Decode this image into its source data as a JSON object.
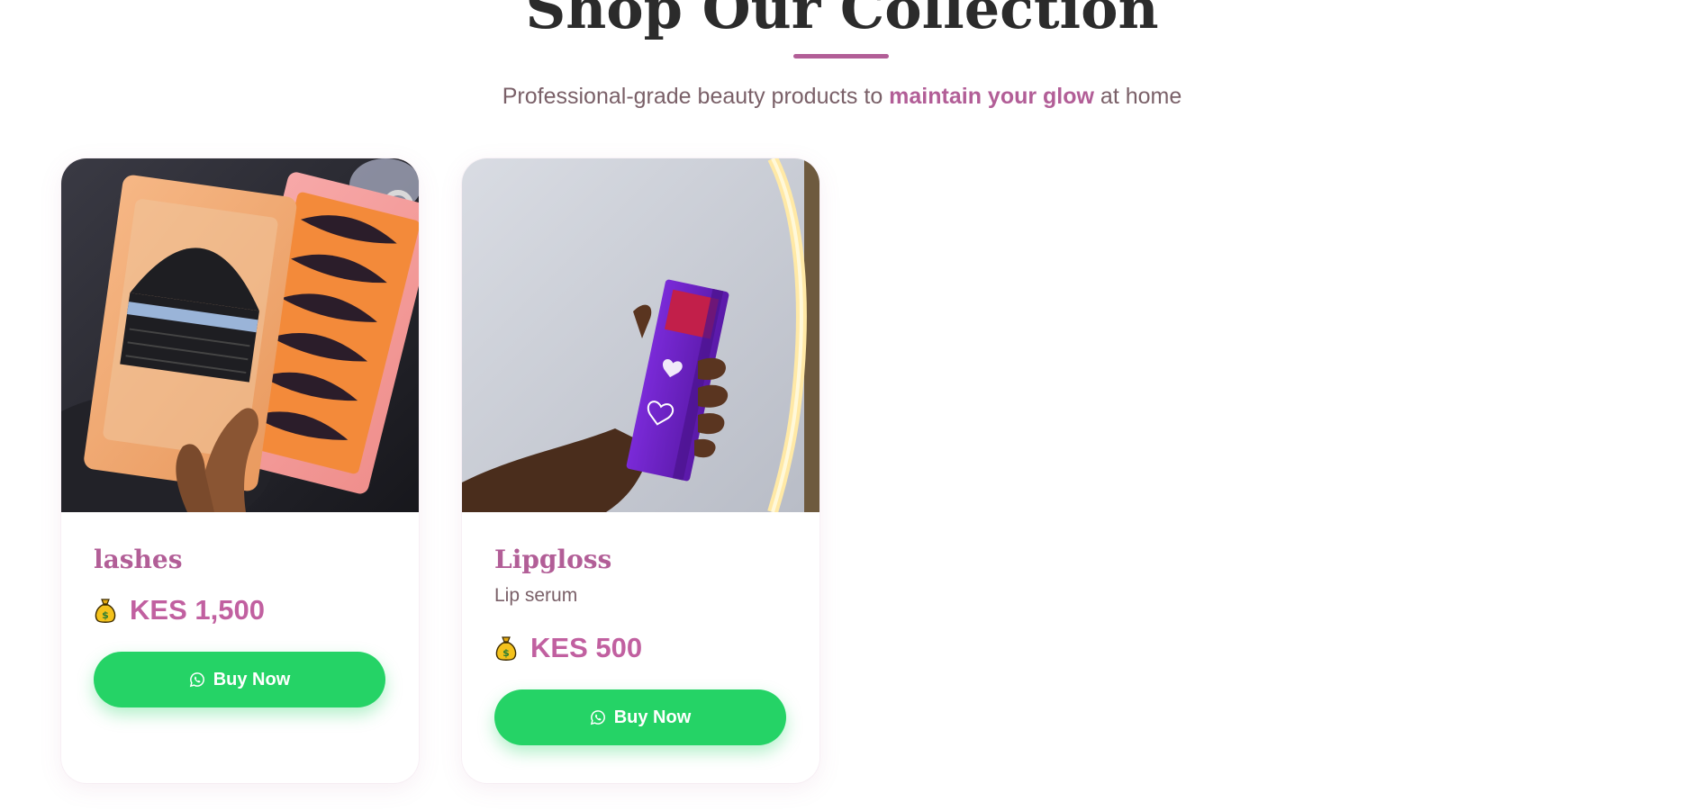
{
  "section": {
    "title": "Shop Our Collection",
    "subtitle_pre": "Professional-grade beauty products to ",
    "subtitle_highlight": "maintain your glow",
    "subtitle_post": " at home"
  },
  "colors": {
    "accent": "#b25e97",
    "price": "#c160a0",
    "button": "#25d366"
  },
  "products": [
    {
      "name": "lashes",
      "description": "",
      "price": "KES 1,500",
      "price_icon": "money-bag-icon",
      "button_label": "Buy Now",
      "button_icon": "whatsapp-icon"
    },
    {
      "name": "Lipgloss",
      "description": "Lip serum",
      "price": "KES 500",
      "price_icon": "money-bag-icon",
      "button_label": "Buy Now",
      "button_icon": "whatsapp-icon"
    }
  ]
}
